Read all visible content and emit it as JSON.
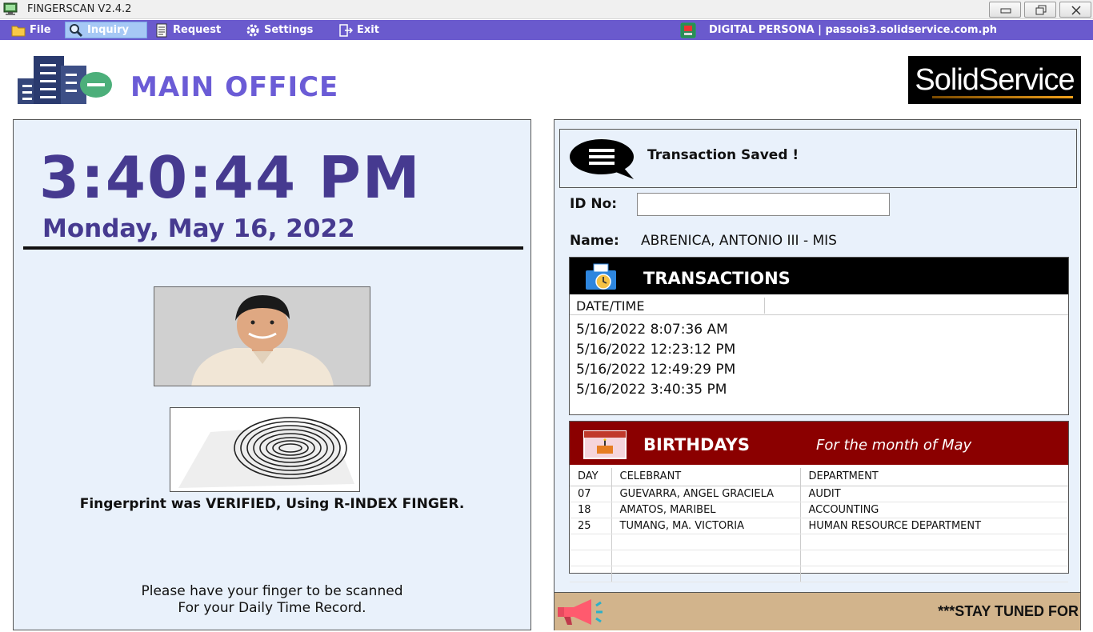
{
  "window": {
    "title": "FINGERSCAN V2.4.2"
  },
  "menu": {
    "items": [
      {
        "label": "File",
        "icon": "folder-icon"
      },
      {
        "label": "Inquiry",
        "icon": "magnifier-icon"
      },
      {
        "label": "Request",
        "icon": "document-icon"
      },
      {
        "label": "Settings",
        "icon": "gear-icon"
      },
      {
        "label": "Exit",
        "icon": "exit-icon"
      }
    ],
    "device": "DIGITAL PERSONA | passois3.solidservice.com.ph"
  },
  "header": {
    "office_title": "MAIN OFFICE",
    "brand": "SolidService"
  },
  "clock": {
    "time": "3:40:44 PM",
    "date": "Monday, May 16, 2022"
  },
  "verification": {
    "message": "Fingerprint was VERIFIED, Using R-INDEX FINGER.",
    "prompt_line1": "Please have your finger to be scanned",
    "prompt_line2": "For your Daily Time Record."
  },
  "notice": {
    "message": "Transaction Saved !"
  },
  "employee": {
    "id_label": "ID No:",
    "id_value": "",
    "name_label": "Name:",
    "name_value": "ABRENICA, ANTONIO III - MIS"
  },
  "transactions": {
    "title": "TRANSACTIONS",
    "column": "DATE/TIME",
    "rows": [
      "5/16/2022 8:07:36 AM",
      "5/16/2022 12:23:12 PM",
      "5/16/2022 12:49:29 PM",
      "5/16/2022 3:40:35 PM"
    ]
  },
  "birthdays": {
    "title": "BIRTHDAYS",
    "subtitle": "For the month of May",
    "columns": [
      "DAY",
      "CELEBRANT",
      "DEPARTMENT"
    ],
    "rows": [
      [
        "07",
        "GUEVARRA, ANGEL GRACIELA",
        "AUDIT"
      ],
      [
        "18",
        "AMATOS, MARIBEL",
        "ACCOUNTING"
      ],
      [
        "25",
        "TUMANG, MA. VICTORIA",
        "HUMAN RESOURCE DEPARTMENT"
      ]
    ]
  },
  "ticker": {
    "text": "***STAY TUNED FOR"
  },
  "colors": {
    "menu_bar": "#6a5acd",
    "accent_text": "#463a90",
    "panel_bg": "#e9f1fb",
    "birthday_header": "#8b0000",
    "ticker_bg": "#d2b48c"
  }
}
